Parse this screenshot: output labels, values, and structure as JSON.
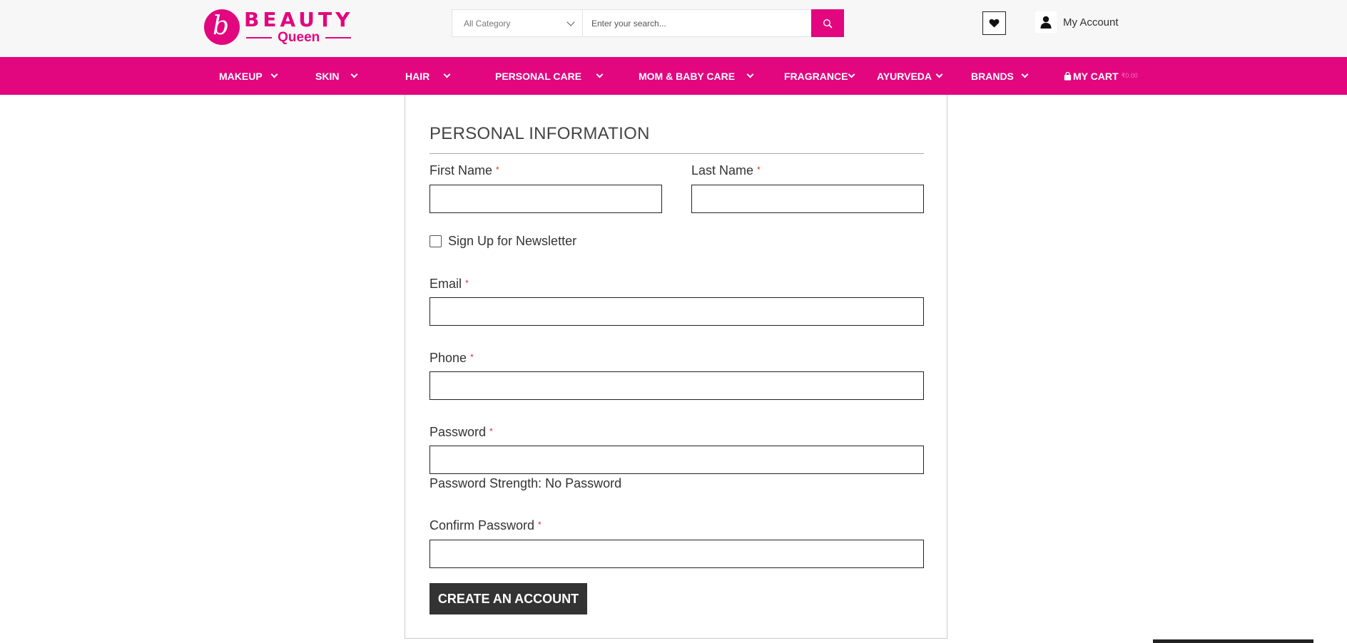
{
  "brand": {
    "letter": "b",
    "name_top": "BEAUTY",
    "name_bottom": "Queen",
    "color": "#e2067f"
  },
  "search": {
    "category": "All Category",
    "placeholder": "Enter your search...",
    "icon": "search-icon"
  },
  "header": {
    "wishlist_icon": "heart-icon",
    "account_icon": "user-icon",
    "account_label": "My Account"
  },
  "nav": {
    "items": [
      {
        "label": "MAKEUP"
      },
      {
        "label": "SKIN"
      },
      {
        "label": "HAIR"
      },
      {
        "label": "PERSONAL CARE"
      },
      {
        "label": "MOM & BABY CARE"
      },
      {
        "label": "FRAGRANCE"
      },
      {
        "label": "AYURVEDA"
      },
      {
        "label": "BRANDS"
      }
    ],
    "cart": {
      "label": "MY CART",
      "price": "₹0.00",
      "icon": "bag-icon"
    }
  },
  "form": {
    "section_title": "PERSONAL INFORMATION",
    "required_mark": "*",
    "first_name": {
      "label": "First Name",
      "value": ""
    },
    "last_name": {
      "label": "Last Name",
      "value": ""
    },
    "newsletter": {
      "label": "Sign Up for Newsletter",
      "checked": false
    },
    "email": {
      "label": "Email",
      "value": ""
    },
    "phone": {
      "label": "Phone",
      "value": ""
    },
    "password": {
      "label": "Password",
      "value": ""
    },
    "password_strength": "Password Strength: No Password",
    "confirm_password": {
      "label": "Confirm Password",
      "value": ""
    },
    "submit_label": "CREATE AN ACCOUNT"
  },
  "colors": {
    "accent": "#e2067f",
    "nav_text": "#ffffff",
    "button_bg": "#333333",
    "required": "#e02b27"
  }
}
